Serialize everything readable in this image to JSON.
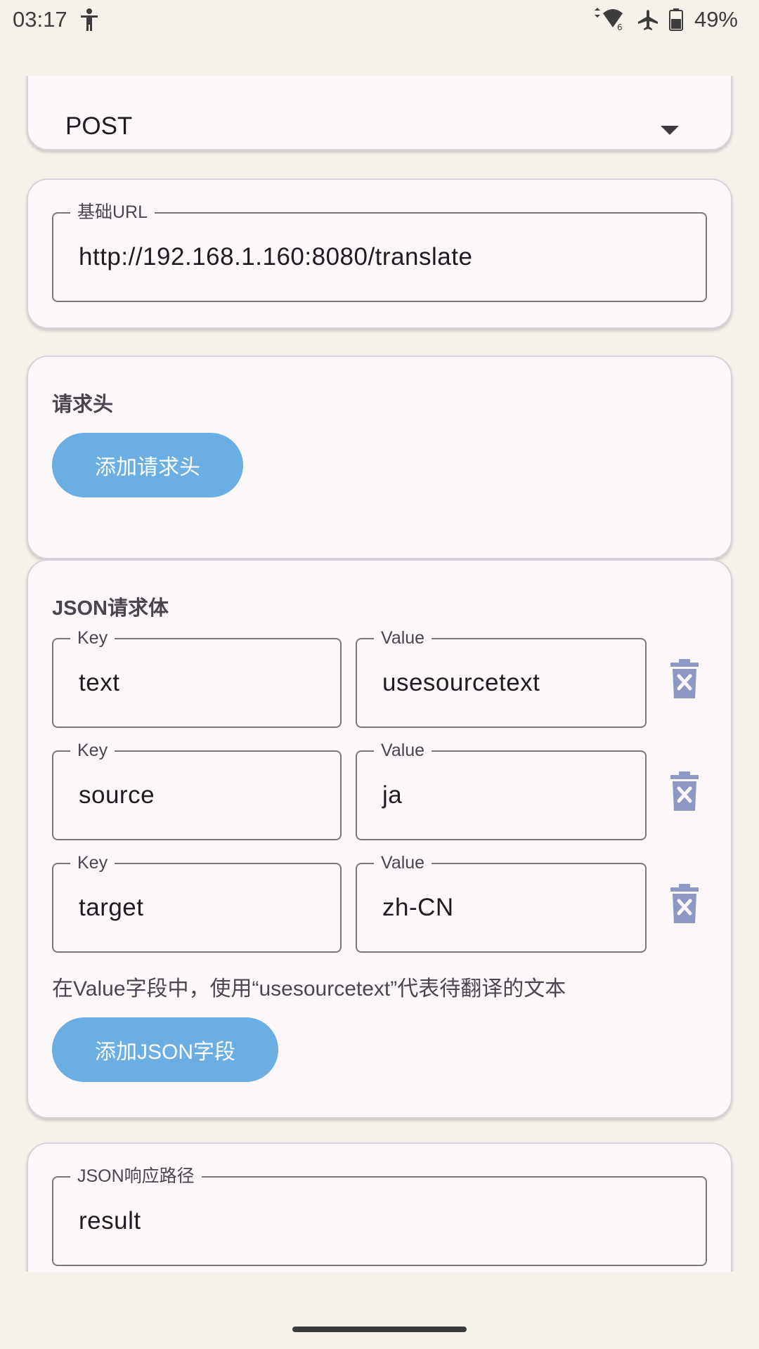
{
  "status_bar": {
    "time": "03:17",
    "battery": "49%",
    "icons": [
      "accessibility-icon",
      "wifi-icon",
      "airplane-icon",
      "battery-icon"
    ]
  },
  "method": {
    "value": "POST"
  },
  "base_url": {
    "label": "基础URL",
    "value": "http://192.168.1.160:8080/translate"
  },
  "headers": {
    "title": "请求头",
    "add_button": "添加请求头"
  },
  "json_body": {
    "title": "JSON请求体",
    "key_label": "Key",
    "value_label": "Value",
    "rows": [
      {
        "key": "text",
        "value": "usesourcetext"
      },
      {
        "key": "source",
        "value": "ja"
      },
      {
        "key": "target",
        "value": "zh-CN"
      }
    ],
    "hint": "在Value字段中，使用“usesourcetext”代表待翻译的文本",
    "add_button": "添加JSON字段"
  },
  "response_path": {
    "label": "JSON响应路径",
    "value": "result"
  },
  "colors": {
    "accent": "#6aaee4",
    "card_bg": "#fcf7f8",
    "page_bg": "#f5f2ec",
    "trash": "#8d98c4"
  }
}
